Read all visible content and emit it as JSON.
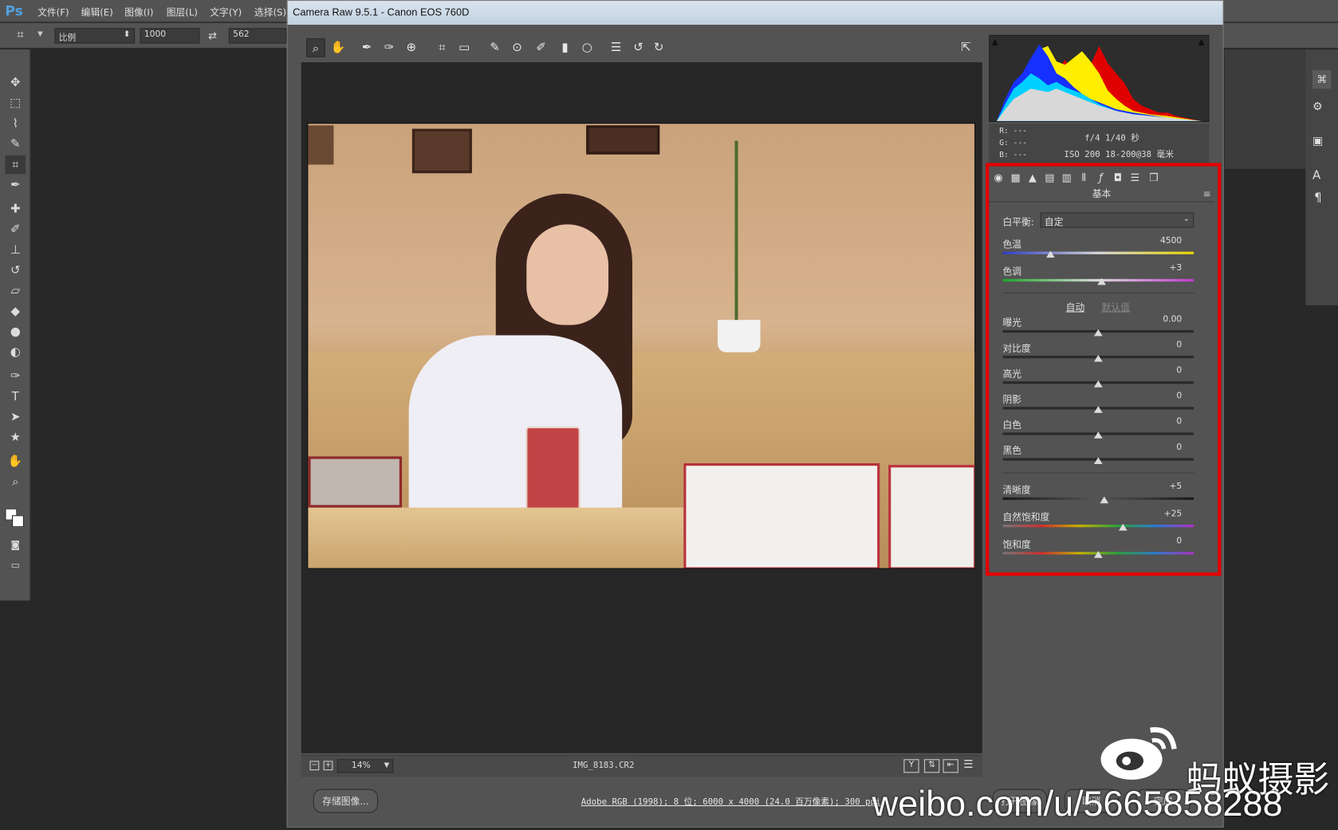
{
  "photoshop": {
    "logo": "Ps",
    "menu": [
      "文件(F)",
      "编辑(E)",
      "图像(I)",
      "图层(L)",
      "文字(Y)",
      "选择(S)"
    ],
    "options": {
      "ratio_label": "比例",
      "width": "1000",
      "height": "562"
    }
  },
  "dialog": {
    "title": "Camera Raw 9.5.1 -  Canon EOS 760D",
    "zoom": "14%",
    "filename": "IMG_8183.CR2",
    "save_button": "存储图像...",
    "workflow_link": "Adobe RGB (1998); 8 位; 6000 x 4000 (24.0 百万像素); 300 ppi",
    "open_button": "打开图像",
    "cancel_button": "取消",
    "done_button": "完成"
  },
  "info": {
    "r_label": "R:",
    "r_val": "---",
    "g_label": "G:",
    "g_val": "---",
    "b_label": "B:",
    "b_val": "---",
    "exposure": "f/4   1/40 秒",
    "iso_lens": "ISO 200   18-200@38 毫米"
  },
  "basic_panel": {
    "title": "基本",
    "white_balance_label": "白平衡:",
    "white_balance_value": "自定",
    "auto_link": "自动",
    "default_link": "默认值",
    "sliders": [
      {
        "label": "色温",
        "value": "4500",
        "pos": 0.25
      },
      {
        "label": "色调",
        "value": "+3",
        "pos": 0.52
      },
      {
        "label": "曝光",
        "value": "0.00",
        "pos": 0.5
      },
      {
        "label": "对比度",
        "value": "0",
        "pos": 0.5
      },
      {
        "label": "高光",
        "value": "0",
        "pos": 0.5
      },
      {
        "label": "阴影",
        "value": "0",
        "pos": 0.5
      },
      {
        "label": "白色",
        "value": "0",
        "pos": 0.5
      },
      {
        "label": "黑色",
        "value": "0",
        "pos": 0.5
      },
      {
        "label": "清晰度",
        "value": "+5",
        "pos": 0.53
      },
      {
        "label": "自然饱和度",
        "value": "+25",
        "pos": 0.63
      },
      {
        "label": "饱和度",
        "value": "0",
        "pos": 0.5
      }
    ]
  },
  "watermark": {
    "brand": "蚂蚁摄影",
    "url": "weibo.com/u/5665858288"
  },
  "colors": {
    "highlight_frame": "#e30000",
    "ps_blue": "#4fa3e0"
  }
}
